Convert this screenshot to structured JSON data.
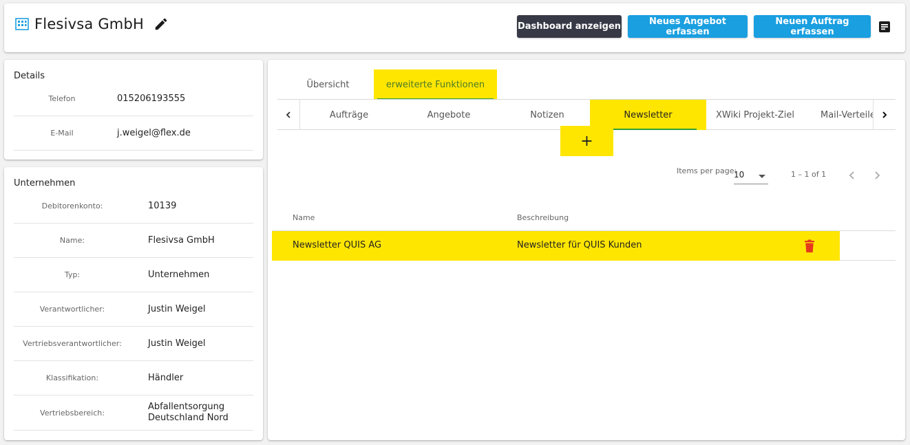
{
  "header": {
    "company_icon": "building-icon",
    "title": "Flesivsa GmbH",
    "edit_icon": "pencil-icon",
    "buttons": {
      "dashboard": "Dashboard anzeigen",
      "new_offer": "Neues Angebot erfassen",
      "new_order": "Neuen Auftrag erfassen"
    },
    "menu_icon": "document-list-icon"
  },
  "details": {
    "title": "Details",
    "rows": [
      {
        "label": "Telefon",
        "value": "015206193555"
      },
      {
        "label": "E-Mail",
        "value": "j.weigel@flex.de"
      }
    ]
  },
  "unternehmen": {
    "title": "Unternehmen",
    "rows": [
      {
        "label": "Debitorenkonto:",
        "value": "10139"
      },
      {
        "label": "Name:",
        "value": "Flesivsa GmbH"
      },
      {
        "label": "Typ:",
        "value": "Unternehmen"
      },
      {
        "label": "Verantwortlicher:",
        "value": "Justin Weigel"
      },
      {
        "label": "Vertriebsverantwortlicher:",
        "value": "Justin Weigel"
      },
      {
        "label": "Klassifikation:",
        "value": "Händler"
      },
      {
        "label": "Vertriebsbereich:",
        "value": "Abfallentsorgung",
        "value2": "Deutschland Nord"
      }
    ]
  },
  "main": {
    "top_tabs": [
      "Übersicht",
      "erweiterte Funktionen"
    ],
    "sub_tabs": [
      "Aufträge",
      "Angebote",
      "Notizen",
      "Newsletter",
      "XWiki Projekt-Ziel",
      "Mail-Verteiler"
    ],
    "add_label": "+",
    "paginator": {
      "items_per_page_label": "Items per page:",
      "items_per_page_value": "10",
      "range": "1 – 1 of 1"
    },
    "table": {
      "headers": [
        "Name",
        "Beschreibung"
      ],
      "rows": [
        {
          "name": "Newsletter QUIS AG",
          "description": "Newsletter für QUIS Kunden"
        }
      ]
    }
  },
  "colors": {
    "highlight": "#ffe600",
    "primary_blue": "#1a9fe0",
    "dark_button": "#373a46",
    "active_underline": "#2e9e3a",
    "delete_red": "#e53b1c"
  }
}
